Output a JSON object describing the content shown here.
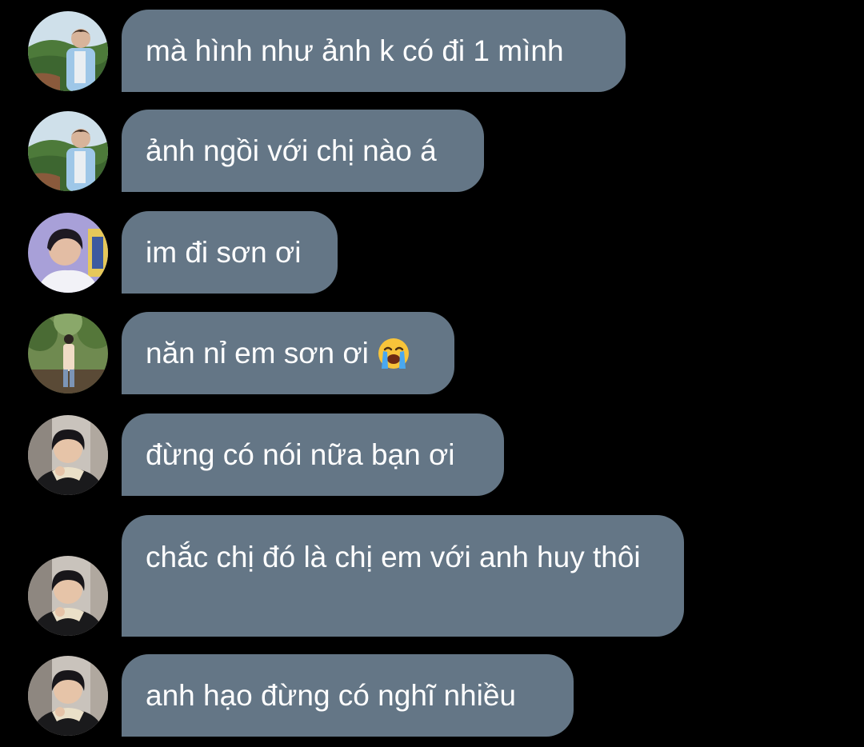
{
  "messages": [
    {
      "text": "mà hình như ảnh k có đi 1 mình",
      "avatar": "avatar-outdoor-hills"
    },
    {
      "text": "ảnh ngồi với chị nào á",
      "avatar": "avatar-outdoor-hills"
    },
    {
      "text": "im đi sơn ơi",
      "avatar": "avatar-purple-bg"
    },
    {
      "text": "năn nỉ em sơn ơi",
      "avatar": "avatar-forest-walk",
      "emoji": "loudly-crying-face-emoji"
    },
    {
      "text": "đừng có nói nữa bạn ơi",
      "avatar": "avatar-black-jacket"
    },
    {
      "text": "chắc chị đó là chị em với anh huy thôi",
      "avatar": "avatar-black-jacket"
    },
    {
      "text": "anh hạo đừng có nghĩ nhiều",
      "avatar": "avatar-black-jacket"
    }
  ],
  "colors": {
    "background": "#000000",
    "bubble": "#647686",
    "text": "#ffffff"
  }
}
